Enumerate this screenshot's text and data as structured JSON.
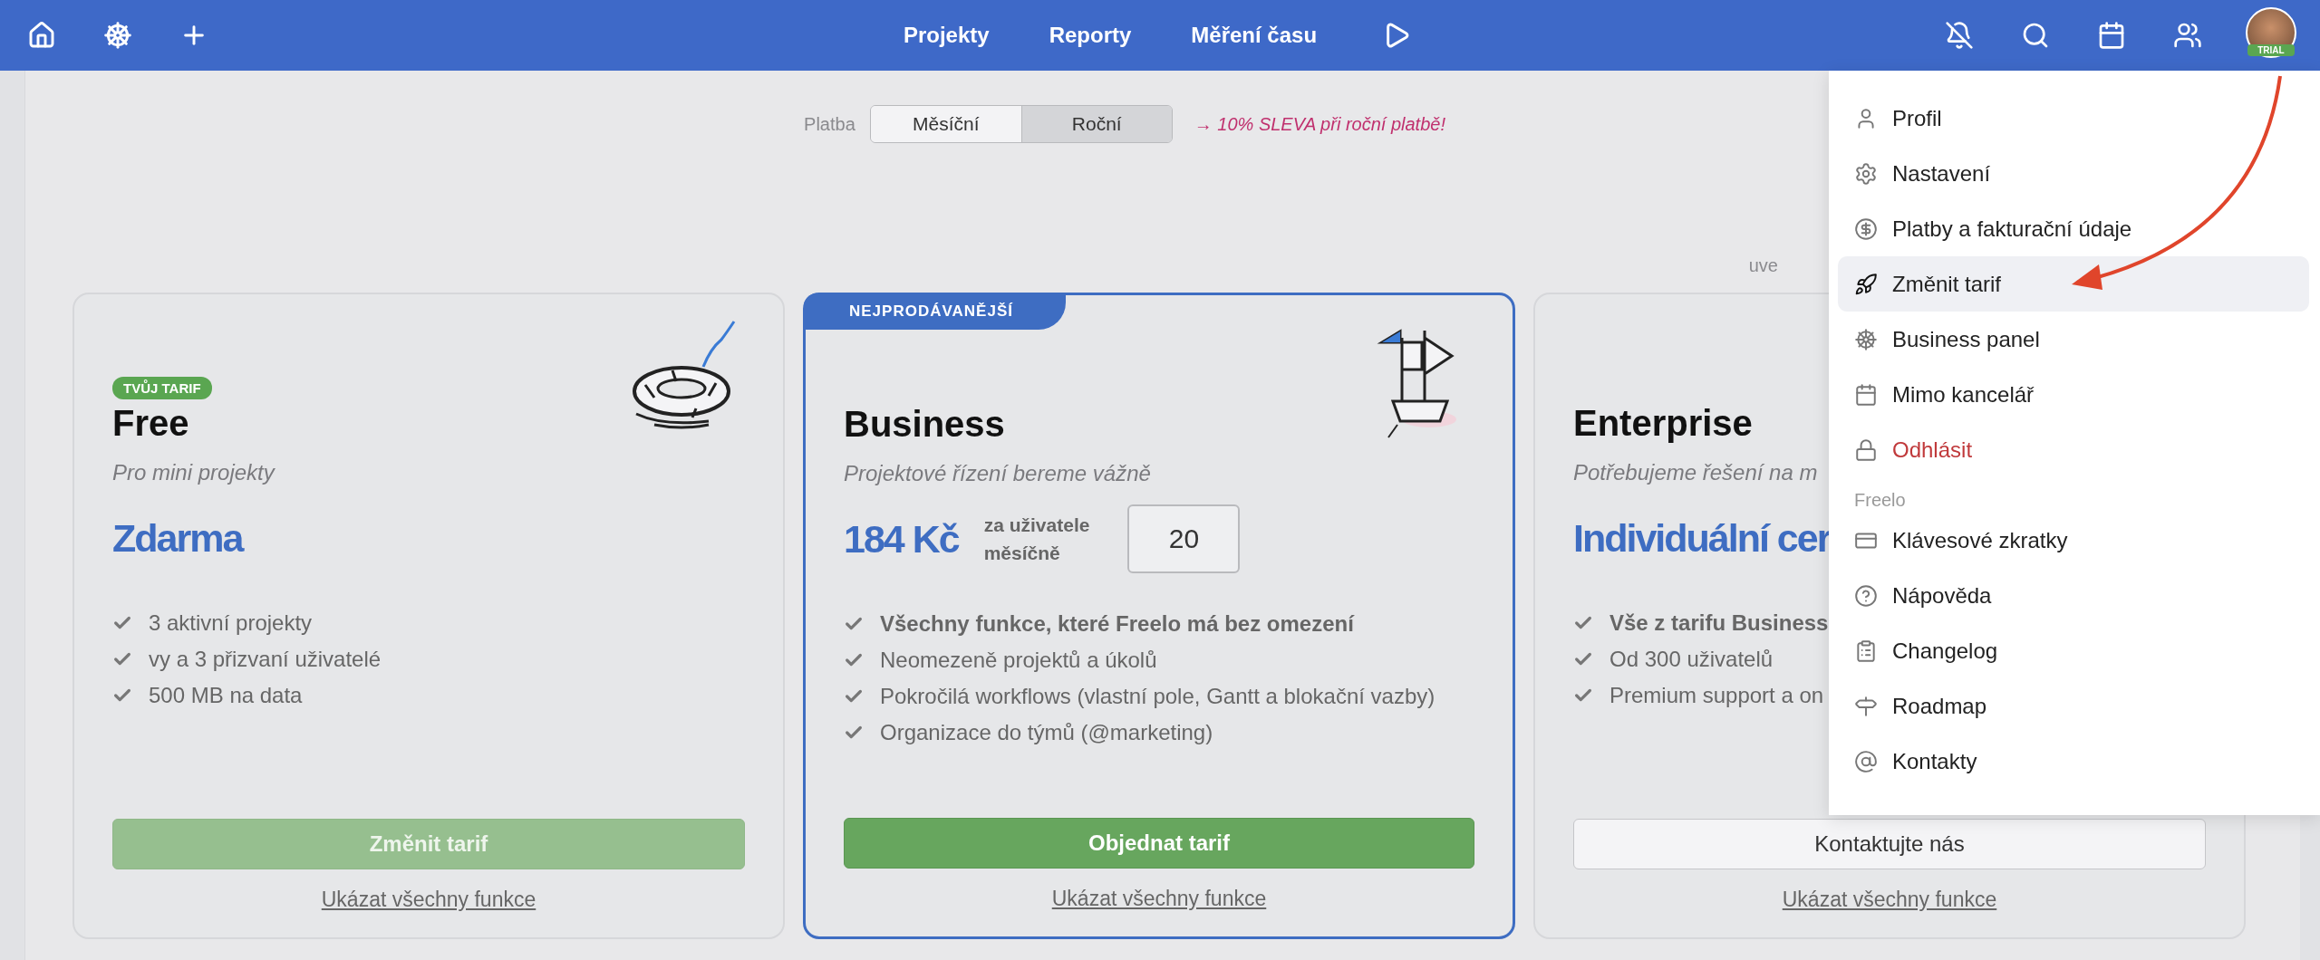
{
  "topbar": {
    "nav": [
      {
        "label": "Projekty"
      },
      {
        "label": "Reporty"
      },
      {
        "label": "Měření času"
      }
    ],
    "avatar_badge": "TRIAL"
  },
  "billing": {
    "label": "Platba",
    "options": [
      {
        "label": "Měsíční",
        "selected": false
      },
      {
        "label": "Roční",
        "selected": true
      }
    ],
    "promo": "→ 10% SLEVA při roční platbě!"
  },
  "note": "uve",
  "plans": [
    {
      "badge": "TVŮJ TARIF",
      "name": "Free",
      "tagline": "Pro mini projekty",
      "price": "Zdarma",
      "features": [
        {
          "text": "3 aktivní projekty",
          "bold": false
        },
        {
          "text": "vy a 3 přizvaní uživatelé",
          "bold": false
        },
        {
          "text": "500 MB na data",
          "bold": false
        }
      ],
      "button": {
        "label": "Změnit tarif",
        "kind": "disabled"
      },
      "link": "Ukázat všechny funkce",
      "highlighted": false
    },
    {
      "ribbon": "NEJPRODÁVANĚJŠÍ",
      "name": "Business",
      "tagline": "Projektové řízení bereme vážně",
      "price": "184 Kč",
      "price_note": [
        "za uživatele",
        "měsíčně"
      ],
      "seats": "20",
      "features": [
        {
          "text": "Všechny funkce, které Freelo má bez omezení",
          "bold": true
        },
        {
          "text": "Neomezeně projektů a úkolů",
          "bold": false
        },
        {
          "text": "Pokročilá workflows (vlastní pole, Gantt a blokační vazby)",
          "bold": false
        },
        {
          "text": "Organizace do týmů (@marketing)",
          "bold": false
        }
      ],
      "button": {
        "label": "Objednat tarif",
        "kind": "primary"
      },
      "link": "Ukázat všechny funkce",
      "highlighted": true
    },
    {
      "name": "Enterprise",
      "tagline": "Potřebujeme řešení na m",
      "price": "Individuální cer",
      "features": [
        {
          "text": "Vše z tarifu Business",
          "bold": true
        },
        {
          "text": "Od 300 uživatelů",
          "bold": false
        },
        {
          "text": "Premium support a on",
          "bold": false
        }
      ],
      "button": {
        "label": "Kontaktujte nás",
        "kind": "outline"
      },
      "link": "Ukázat všechny funkce",
      "highlighted": false
    }
  ],
  "menu": {
    "items": [
      {
        "kind": "item",
        "label": "Profil",
        "selected": false
      },
      {
        "kind": "item",
        "label": "Nastavení",
        "selected": false
      },
      {
        "kind": "item",
        "label": "Platby a fakturační údaje",
        "selected": false
      },
      {
        "kind": "item",
        "label": "Změnit tarif",
        "selected": true
      },
      {
        "kind": "item",
        "label": "Business panel",
        "selected": false
      },
      {
        "kind": "item",
        "label": "Mimo kancelář",
        "selected": false
      },
      {
        "kind": "danger",
        "label": "Odhlásit",
        "selected": false
      },
      {
        "kind": "section",
        "label": "Freelo"
      },
      {
        "kind": "item",
        "label": "Klávesové zkratky",
        "selected": false
      },
      {
        "kind": "item",
        "label": "Nápověda",
        "selected": false
      },
      {
        "kind": "item",
        "label": "Changelog",
        "selected": false
      },
      {
        "kind": "item",
        "label": "Roadmap",
        "selected": false
      },
      {
        "kind": "item",
        "label": "Kontakty",
        "selected": false
      }
    ]
  }
}
